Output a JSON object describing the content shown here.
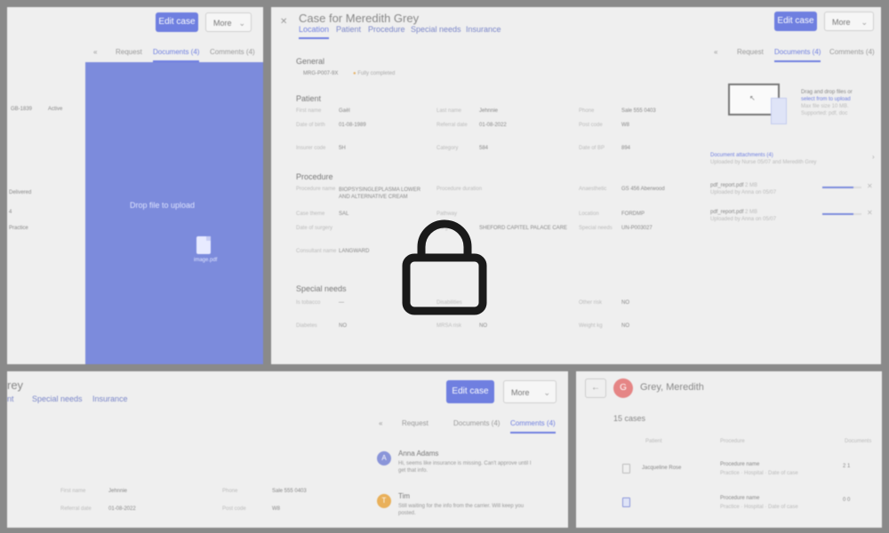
{
  "header": {
    "title": "Case for Meredith Grey",
    "edit_label": "Edit case",
    "more_label": "More"
  },
  "main_tabs": [
    "Location",
    "Patient",
    "Procedure",
    "Special needs",
    "Insurance"
  ],
  "right_tabs": {
    "left_arrow": "«",
    "items": [
      "Request",
      "Documents (4)",
      "Comments (4)"
    ]
  },
  "general": {
    "title": "General",
    "case_id": "MRG-P007-9X",
    "status": "Fully completed"
  },
  "patient": {
    "title": "Patient",
    "fields": [
      {
        "label": "First name",
        "value": "Gaël"
      },
      {
        "label": "Last name",
        "value": "Jehnnie"
      },
      {
        "label": "Phone",
        "value": "Sale 555 0403"
      },
      {
        "label": "Date of birth",
        "value": "01-08-1989"
      },
      {
        "label": "Referral date",
        "value": "01-08-2022"
      },
      {
        "label": "Post code",
        "value": "W8"
      },
      {
        "label": "Insurer code",
        "value": "5H"
      },
      {
        "label": "Category",
        "value": "584"
      },
      {
        "label": "Date of BP",
        "value": "894"
      }
    ]
  },
  "procedure": {
    "title": "Procedure",
    "fields": [
      {
        "label": "Procedure name",
        "value": "BIOPSYSINGLEPLASMA LOWER AND ALTERNATIVE CREAM"
      },
      {
        "label": "Procedure duration",
        "value": ""
      },
      {
        "label": "Anaesthetic",
        "value": "GS 456 Aberwood"
      },
      {
        "label": "Case theme",
        "value": "SAL"
      },
      {
        "label": "Pathway",
        "value": ""
      },
      {
        "label": "Location",
        "value": "FORDMP"
      },
      {
        "label": "Date of surgery",
        "value": ""
      },
      {
        "label": "Surgeon",
        "value": "SHEFORD CAPITEL PALACE CARE"
      },
      {
        "label": "Special needs",
        "value": "UN-P003027"
      },
      {
        "label": "Consultant name",
        "value": "LANGWARD"
      }
    ]
  },
  "special": {
    "title": "Special needs",
    "fields": [
      {
        "label": "Is tobacco",
        "value": "—"
      },
      {
        "label": "Disabilities",
        "value": ""
      },
      {
        "label": "Other risk",
        "value": "NO"
      },
      {
        "label": "Diabetes",
        "value": "NO"
      },
      {
        "label": "MRSA risk",
        "value": "NO"
      },
      {
        "label": "Weight kg",
        "value": "NO"
      }
    ]
  },
  "upload": {
    "drag_text": "Drag and drop files or",
    "link_text": "select from to upload",
    "hint": "Max file size 10 MB. Supported: pdf, doc",
    "attached_text": "Document attachments (4)",
    "attached_sub": "Uploaded by Nurse 05/07 and Meredith Grey",
    "files": [
      {
        "name": "pdf_report.pdf",
        "size": "2 MB",
        "meta": "Uploaded by Anna on 05/07",
        "progress": 0.8
      },
      {
        "name": "pdf_report.pdf",
        "size": "2 MB",
        "meta": "Uploaded by Anna on 05/07",
        "progress": 0.8
      }
    ]
  },
  "left_panel": {
    "drop_text": "Drop file to upload",
    "file_name": "image.pdf",
    "edit_label": "Edit case",
    "more_label": "More",
    "tabs": [
      "«",
      "Request",
      "Documents (4)",
      "Comments (4)"
    ],
    "values": [
      "GB-1839",
      "Active",
      "Delivered",
      "4",
      "Practice"
    ]
  },
  "bottom_left": {
    "title_fragment": "rey",
    "tabs": [
      "nt",
      "Special needs",
      "Insurance"
    ],
    "edit_label": "Edit case",
    "more_label": "More",
    "right_tabs": [
      "«",
      "Request",
      "Documents (4)",
      "Comments (4)"
    ],
    "fields": [
      {
        "label": "First name",
        "value": "Jehnnie"
      },
      {
        "label": "Phone",
        "value": "Sale 555 0403"
      },
      {
        "label": "Referral date",
        "value": "01-08-2022"
      },
      {
        "label": "Post code",
        "value": "W8"
      }
    ],
    "comments": [
      {
        "initial": "A",
        "name": "Anna Adams",
        "text": "Hi, seems like insurance is missing. Can't approve until I get that info.",
        "color": "#8a95d9"
      },
      {
        "initial": "T",
        "name": "Tim",
        "text": "Still waiting for the info from the carrier. Will keep you posted.",
        "color": "#e9b05a"
      }
    ]
  },
  "bottom_right": {
    "back_icon": "←",
    "avatar_initial": "G",
    "name": "Grey, Meredith",
    "count_label": "15 cases",
    "columns": [
      "Patient",
      "Procedure",
      "Documents"
    ],
    "rows": [
      {
        "patient": "Jacqueline Rose",
        "procedure": "Procedure name",
        "meta": "Practice · Hospital · Date of case",
        "docs": "2  1"
      },
      {
        "patient": "",
        "procedure": "Procedure name",
        "meta": "Practice · Hospital · Date of case",
        "docs": "0  0"
      }
    ]
  },
  "colors": {
    "accent": "#6f7fe0",
    "dropzone": "#7c8bdc",
    "background": "#8a8a8a",
    "panel": "#efefef"
  },
  "icons": [
    "lock-icon",
    "close-icon",
    "file-icon",
    "chevron-down-icon",
    "back-arrow-icon",
    "document-icon"
  ]
}
